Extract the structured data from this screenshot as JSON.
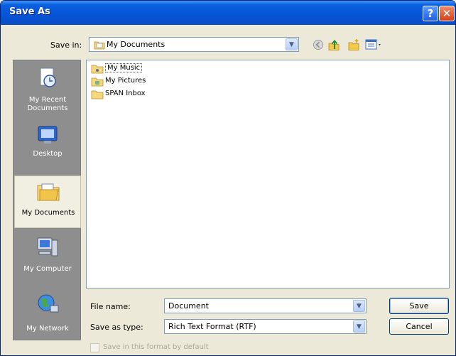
{
  "window": {
    "title": "Save As",
    "help_glyph": "?",
    "close_glyph": "✕"
  },
  "toolbar": {
    "save_in_label": "Save in:",
    "save_in_value": "My Documents",
    "icons": [
      "back-icon",
      "up-folder-icon",
      "new-folder-icon",
      "views-menu-icon"
    ]
  },
  "places": {
    "items": [
      {
        "label": "My Recent Documents",
        "icon": "recent-documents-icon",
        "selected": false
      },
      {
        "label": "Desktop",
        "icon": "desktop-icon",
        "selected": false
      },
      {
        "label": "My Documents",
        "icon": "my-documents-icon",
        "selected": true
      },
      {
        "label": "My Computer",
        "icon": "my-computer-icon",
        "selected": false
      },
      {
        "label": "My Network",
        "icon": "my-network-icon",
        "selected": false
      }
    ]
  },
  "files": {
    "items": [
      {
        "label": "My Music",
        "icon": "folder-icon",
        "focused": true
      },
      {
        "label": "My Pictures",
        "icon": "folder-icon",
        "focused": false
      },
      {
        "label": "SPAN Inbox",
        "icon": "folder-icon",
        "focused": false
      }
    ]
  },
  "form": {
    "file_name_label": "File name:",
    "file_name_value": "Document",
    "save_as_type_label": "Save as type:",
    "save_as_type_value": "Rich Text Format (RTF)",
    "save_button": "Save",
    "cancel_button": "Cancel",
    "default_format_checkbox": "Save in this format by default"
  },
  "colors": {
    "titlebar": "#0554d6",
    "dialog_bg": "#ece9d8",
    "places_bar": "#8e8e8e"
  }
}
